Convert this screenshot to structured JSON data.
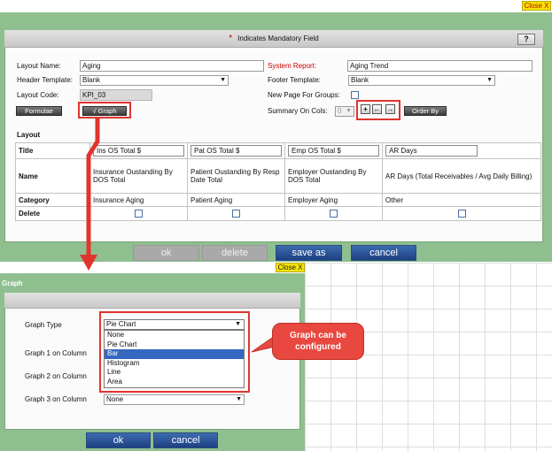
{
  "top_close": "Close X",
  "main": {
    "mandatory_note": "Indicates Mandatory Field",
    "mandatory_star": "*",
    "help": "?",
    "layout_name_label": "Layout Name:",
    "layout_name_value": "Aging",
    "system_report_label": "System Report:",
    "system_report_value": "Aging Trend",
    "header_template_label": "Header Template:",
    "header_template_value": "Blank",
    "footer_template_label": "Footer Template:",
    "footer_template_value": "Blank",
    "layout_code_label": "Layout Code:",
    "layout_code_value": "KPI_03",
    "new_page_label": "New Page For Groups:",
    "formulae": "Formulae",
    "graph": "√ Graph",
    "summary_label": "Summary On Cols:",
    "summary_value": "0",
    "order_by": "Order By",
    "arrow_plus": "+",
    "arrow_left": "←",
    "arrow_right": "→",
    "layout_heading": "Layout",
    "rows": {
      "title": "Title",
      "name": "Name",
      "category": "Category",
      "delete": "Delete"
    },
    "columns": [
      {
        "title": "Ins OS  Total $",
        "name": "Insurance Oustanding By DOS Total",
        "category": "Insurance Aging"
      },
      {
        "title": "Pat OS  Total $",
        "name": "Patient Oustanding By Resp Date Total",
        "category": "Patient Aging"
      },
      {
        "title": "Emp OS  Total $",
        "name": "Employer Oustanding By DOS Total",
        "category": "Employer Aging"
      },
      {
        "title": "AR Days",
        "name": "AR Days (Total Receivables / Avg Daily Billing)",
        "category": "Other"
      }
    ],
    "buttons": {
      "ok": "ok",
      "delete": "delete",
      "save_as": "save as",
      "cancel": "cancel"
    }
  },
  "graph_dialog": {
    "close": "Close X",
    "title": "Graph",
    "graph_type_label": "Graph Type",
    "graph_type_value": "Pie Chart",
    "graph1_label": "Graph 1 on Column",
    "graph2_label": "Graph 2 on Column",
    "graph3_label": "Graph 3 on Column",
    "graph3_value": "None",
    "options": [
      "None",
      "Pie Chart",
      "Bar",
      "Histogram",
      "Line",
      "Area"
    ],
    "highlighted_option": "Bar",
    "buttons": {
      "ok": "ok",
      "cancel": "cancel"
    }
  },
  "callout": {
    "line1": "Graph can be",
    "line2": "configured"
  },
  "colors": {
    "accent_red": "#e0352f",
    "panel_green": "#8fbf8f",
    "button_blue": "#2a5699",
    "select_blue": "#3367c0"
  }
}
